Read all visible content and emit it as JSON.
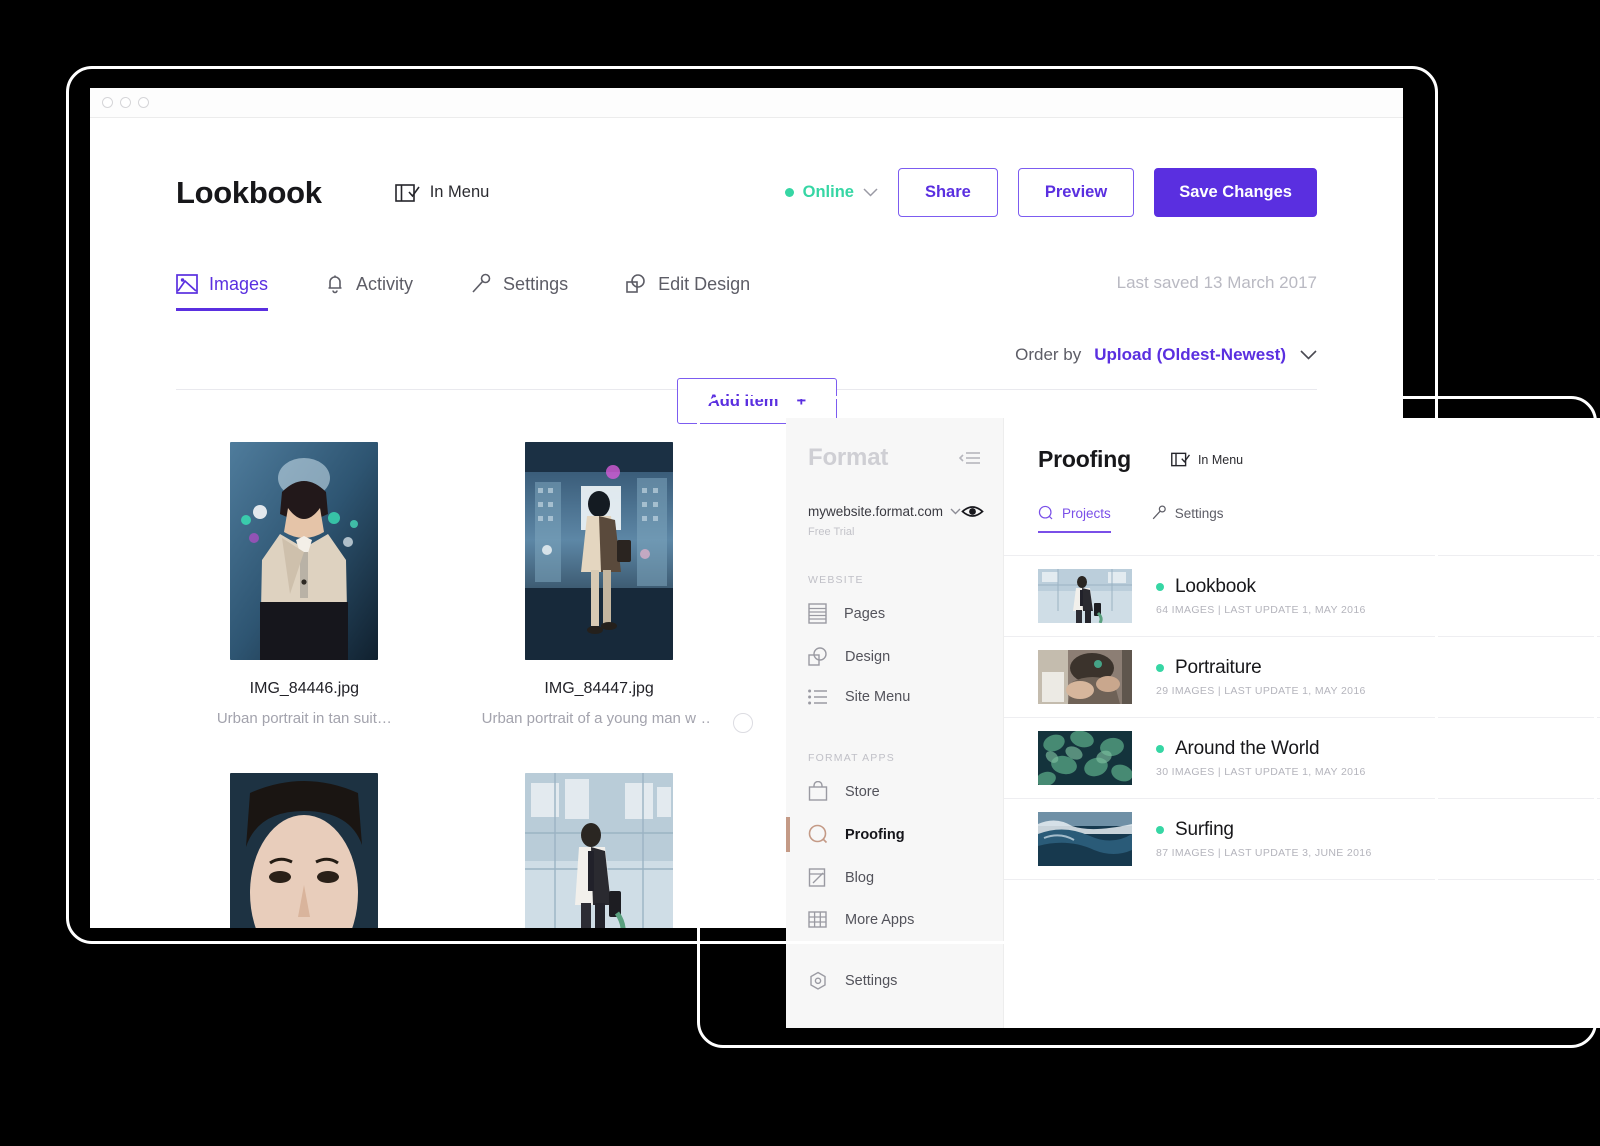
{
  "window": {
    "traffic_lights": [
      "close",
      "minimize",
      "maximize"
    ]
  },
  "header": {
    "title": "Lookbook",
    "in_menu_label": "In Menu",
    "status_label": "Online",
    "buttons": {
      "share": "Share",
      "preview": "Preview",
      "save": "Save Changes"
    }
  },
  "tabs": [
    {
      "label": "Images",
      "icon": "image-icon",
      "active": true
    },
    {
      "label": "Activity",
      "icon": "bell-icon",
      "active": false
    },
    {
      "label": "Settings",
      "icon": "wrench-icon",
      "active": false
    },
    {
      "label": "Edit Design",
      "icon": "design-icon",
      "active": false
    }
  ],
  "last_saved": "Last saved 13 March 2017",
  "toolbar": {
    "order_by_label": "Order by",
    "order_by_value": "Upload (Oldest-Newest)",
    "add_item_label": "Add Item",
    "add_item_plus": "+"
  },
  "gallery": [
    {
      "name": "IMG_84446.jpg",
      "desc": "Urban portrait in tan suit…",
      "art": "man-tan-suit"
    },
    {
      "name": "IMG_84447.jpg",
      "desc": "Urban portrait of a young man walking",
      "art": "man-walking-city"
    },
    {
      "name": "",
      "desc": "",
      "art": "face-closeup"
    },
    {
      "name": "",
      "desc": "",
      "art": "man-street-suit"
    }
  ],
  "format_app": {
    "sidebar": {
      "brand": "Format",
      "site_url": "mywebsite.format.com",
      "site_plan": "Free Trial",
      "sections": [
        {
          "label": "WEBSITE",
          "items": [
            {
              "label": "Pages",
              "icon": "pages-icon",
              "active": false
            },
            {
              "label": "Design",
              "icon": "design-icon",
              "active": false
            },
            {
              "label": "Site Menu",
              "icon": "list-icon",
              "active": false
            }
          ]
        },
        {
          "label": "FORMAT APPS",
          "items": [
            {
              "label": "Store",
              "icon": "bag-icon",
              "active": false
            },
            {
              "label": "Proofing",
              "icon": "proofing-icon",
              "active": true
            },
            {
              "label": "Blog",
              "icon": "blog-icon",
              "active": false
            },
            {
              "label": "More Apps",
              "icon": "grid-icon",
              "active": false
            }
          ]
        }
      ],
      "bottom": {
        "label": "Settings",
        "icon": "gear-icon"
      }
    },
    "content": {
      "title": "Proofing",
      "in_menu_label": "In Menu",
      "tabs": [
        {
          "label": "Projects",
          "icon": "proofing-icon",
          "active": true
        },
        {
          "label": "Settings",
          "icon": "wrench-icon",
          "active": false
        }
      ],
      "projects": [
        {
          "title": "Lookbook",
          "meta": "64 IMAGES | LAST UPDATE 1, MAY 2016",
          "art": "man-street-suit"
        },
        {
          "title": "Portraiture",
          "meta": "29 IMAGES | LAST UPDATE 1, MAY 2016",
          "art": "portrait-hands"
        },
        {
          "title": "Around the World",
          "meta": "30 IMAGES | LAST UPDATE 1, MAY 2016",
          "art": "leaves"
        },
        {
          "title": "Surfing",
          "meta": "87 IMAGES | LAST UPDATE 3, JUNE 2016",
          "art": "wave"
        }
      ]
    }
  },
  "colors": {
    "accent_purple": "#5a2fe0",
    "accent_purple_light": "#7c5cf0",
    "status_green": "#36d6a4",
    "active_tan": "#c49a86",
    "text_dark": "#17171a",
    "text_muted": "#b9b9c2"
  }
}
